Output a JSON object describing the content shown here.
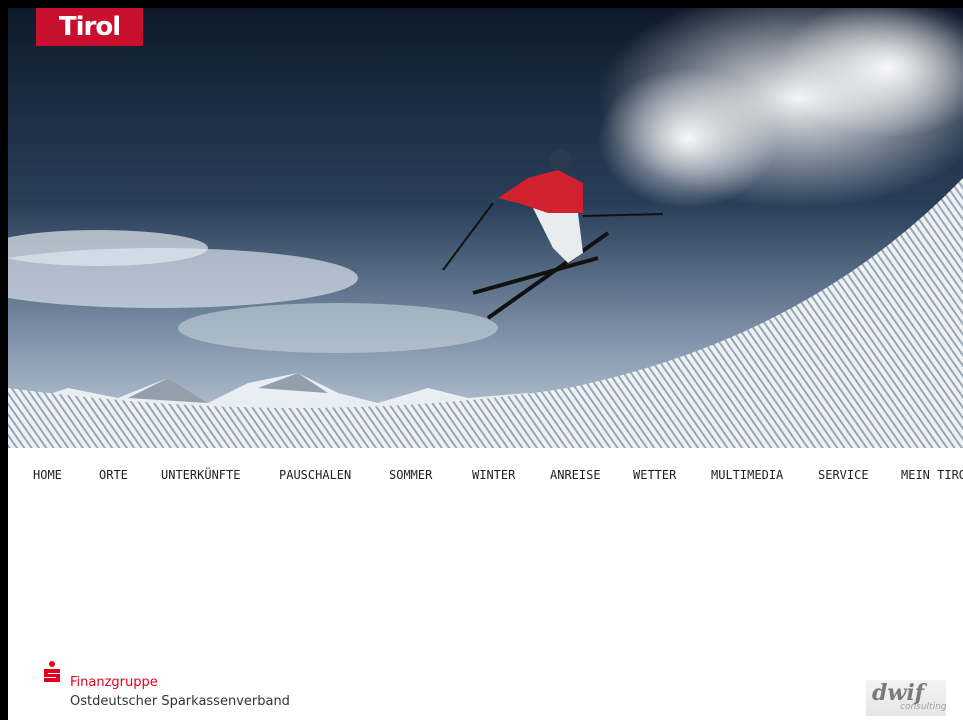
{
  "brand": {
    "logo_text": "Tirol",
    "logo_color": "#c8102e"
  },
  "nav": {
    "items": [
      {
        "id": "home",
        "label": "HOME"
      },
      {
        "id": "orte",
        "label": "ORTE"
      },
      {
        "id": "unterkuenfte",
        "label": "UNTERKÜNFTE"
      },
      {
        "id": "pauschalen",
        "label": "PAUSCHALEN"
      },
      {
        "id": "sommer",
        "label": "SOMMER"
      },
      {
        "id": "winter",
        "label": "WINTER"
      },
      {
        "id": "anreise",
        "label": "ANREISE"
      },
      {
        "id": "wetter",
        "label": "WETTER"
      },
      {
        "id": "multimedia",
        "label": "MULTIMEDIA"
      },
      {
        "id": "service",
        "label": "SERVICE"
      },
      {
        "id": "mein-tirol",
        "label": "MEIN TIROL"
      }
    ]
  },
  "footer": {
    "sparkasse_icon": "sparkasse-s-icon",
    "finanzgruppe": "Finanzgruppe",
    "verband": "Ostdeutscher Sparkassenverband",
    "accent_color": "#e2001a",
    "partner_logo": "dwif",
    "partner_sub": "consulting"
  }
}
